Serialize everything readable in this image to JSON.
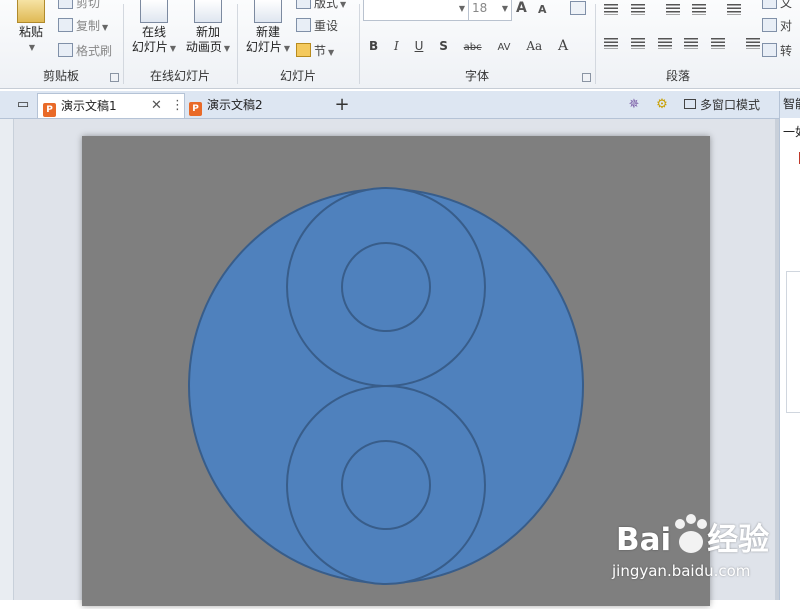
{
  "ribbon": {
    "clipboard": {
      "label": "剪贴板",
      "paste": "粘贴",
      "cut": "剪切",
      "copy": "复制",
      "format_painter": "格式刷"
    },
    "online_slides": {
      "label": "在线幻灯片",
      "online_slide_line1": "在线",
      "online_slide_line2": "幻灯片",
      "new_anim_line1": "新加",
      "new_anim_line2": "动画页"
    },
    "slides": {
      "label": "幻灯片",
      "new_slide_line1": "新建",
      "new_slide_line2": "幻灯片",
      "layout": "版式",
      "reset": "重设",
      "section": "节"
    },
    "font": {
      "label": "字体",
      "size": "18",
      "bold": "B",
      "italic": "I",
      "underline": "U",
      "shadow": "S",
      "strike": "abc",
      "spacing": "AV",
      "case": "Aa",
      "color": "A",
      "grow": "A",
      "shrink": "A"
    },
    "paragraph": {
      "label": "段落",
      "text_dir": "文",
      "align_text": "对",
      "convert": "转"
    }
  },
  "tabs": [
    {
      "label": "演示文稿1",
      "active": true
    },
    {
      "label": "演示文稿2",
      "active": false
    }
  ],
  "tabbar": {
    "add": "+",
    "multi_window": "多窗口模式"
  },
  "right_pane": {
    "title": "智能",
    "text": "一如"
  },
  "watermark": {
    "logo": "Bai",
    "logo2": "经验",
    "domain": "jingyan.baidu.com"
  },
  "colors": {
    "slide_bg": "#7f7f7f",
    "shape_fill": "#4f81bd",
    "shape_stroke": "#385d8a",
    "accent_orange": "#e96a28"
  }
}
